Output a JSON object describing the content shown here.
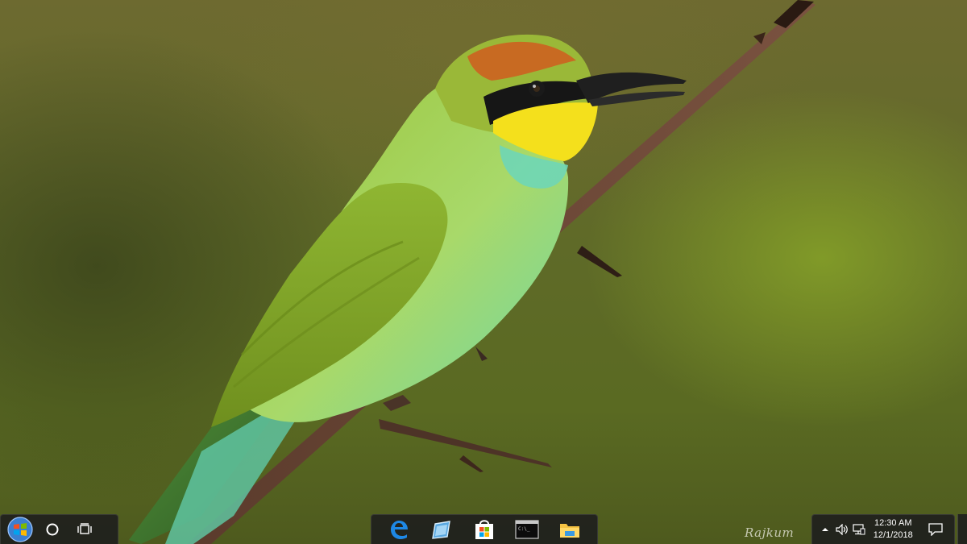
{
  "wallpaper": {
    "subject": "bee-eater-bird-on-branch",
    "signature_text": "Rajkum"
  },
  "taskbar": {
    "left": {
      "start_icon": "windows-orb-icon",
      "search_icon": "cortana-circle-icon",
      "task_view_icon": "task-view-icon"
    },
    "pinned": [
      {
        "name": "edge-icon",
        "label": "Microsoft Edge"
      },
      {
        "name": "app-window-icon",
        "label": "App"
      },
      {
        "name": "store-icon",
        "label": "Microsoft Store"
      },
      {
        "name": "command-prompt-icon",
        "label": "Command Prompt"
      },
      {
        "name": "file-explorer-icon",
        "label": "File Explorer"
      }
    ],
    "tray": {
      "chevron_icon": "chevron-up-icon",
      "volume_icon": "volume-icon",
      "network_icon": "network-icon",
      "time": "12:30 AM",
      "date": "12/1/2018",
      "action_center_icon": "action-center-icon"
    }
  },
  "colors": {
    "taskbar": "#1c1c1e",
    "edge_blue": "#1e88e5",
    "folder_yellow": "#f5c242",
    "bird_green": "#8dbb2e",
    "bird_yellow": "#f4e01c",
    "branch": "#5a3a2a"
  }
}
